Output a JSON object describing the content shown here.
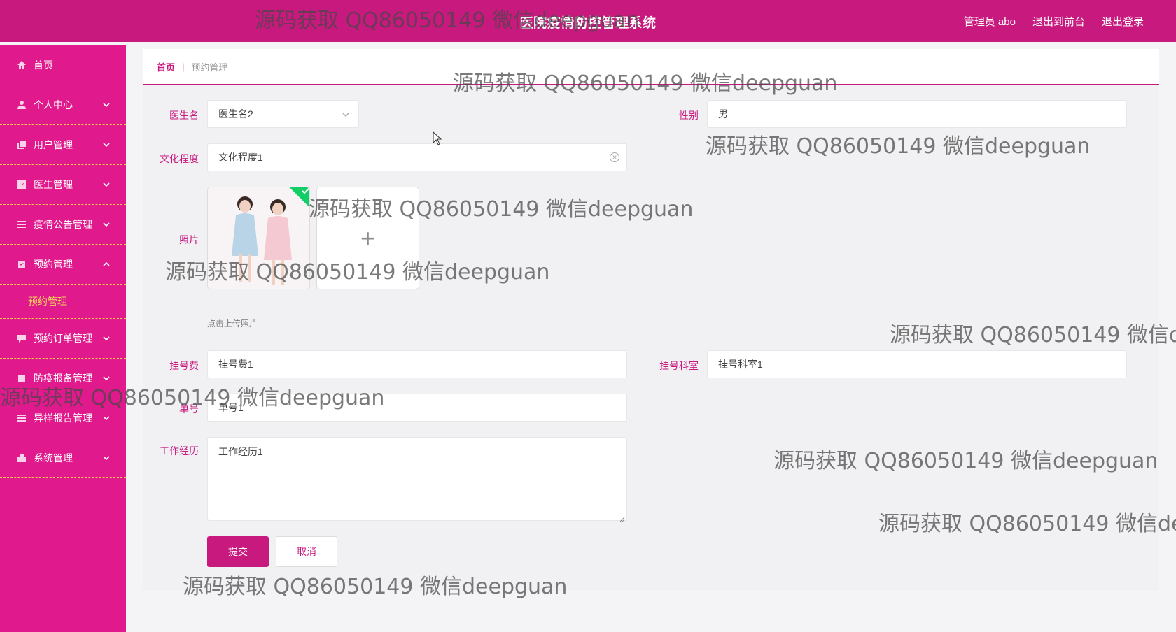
{
  "header": {
    "title": "医院疫情防控管理系统",
    "user_label": "管理员 abo",
    "front_label": "退出到前台",
    "logout_label": "退出登录"
  },
  "sidebar": {
    "items": [
      {
        "label": "首页",
        "icon": "home-icon"
      },
      {
        "label": "个人中心",
        "icon": "user-icon"
      },
      {
        "label": "用户管理",
        "icon": "copy-icon"
      },
      {
        "label": "医生管理",
        "icon": "chart-icon"
      },
      {
        "label": "疫情公告管理",
        "icon": "list-icon"
      },
      {
        "label": "预约管理",
        "icon": "clipboard-icon"
      },
      {
        "label": "预约订单管理",
        "icon": "message-icon"
      },
      {
        "label": "防疫报备管理",
        "icon": "clipboard-icon"
      },
      {
        "label": "异样报告管理",
        "icon": "list-icon"
      },
      {
        "label": "系统管理",
        "icon": "cart-icon"
      }
    ],
    "submenu_label": "预约管理"
  },
  "breadcrumb": {
    "home": "首页",
    "separator": "|",
    "current": "预约管理"
  },
  "form": {
    "doctor_name": {
      "label": "医生名",
      "value": "医生名2"
    },
    "gender": {
      "label": "性别",
      "value": "男"
    },
    "education": {
      "label": "文化程度",
      "value": "文化程度1"
    },
    "photo": {
      "label": "照片",
      "hint": "点击上传照片",
      "add": "+"
    },
    "fee": {
      "label": "挂号费",
      "value": "挂号费1"
    },
    "department": {
      "label": "挂号科室",
      "value": "挂号科室1"
    },
    "order_no": {
      "label": "单号",
      "value": "单号1"
    },
    "experience": {
      "label": "工作经历",
      "value": "工作经历1"
    },
    "submit_label": "提交",
    "cancel_label": "取消"
  },
  "watermark_text": "源码获取 QQ86050149 微信deepguan",
  "watermark_partial": "源码获取 QQ86050149 微信d",
  "watermark_partial2": "源码获取 QQ86050149 微信de",
  "watermark_top": "源码获取 QQ86050149 微信deepguan",
  "colors": {
    "primary": "#c8197f",
    "sidebar": "#e0198c",
    "divider": "#f5c64b",
    "active_sub": "#f5d55a"
  }
}
